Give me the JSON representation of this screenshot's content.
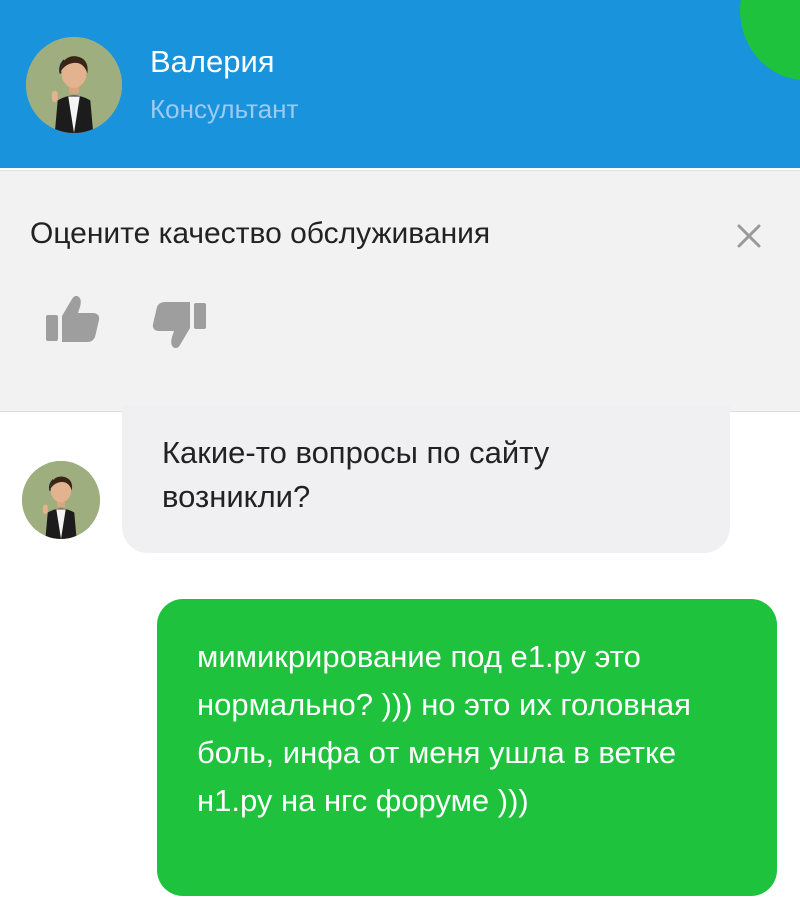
{
  "theme": {
    "header_bg": "#1a93dd",
    "accent_green": "#1ec23d",
    "panel_bg": "#f2f2f2",
    "incoming_bubble_bg": "#f0f0f2",
    "outgoing_bubble_bg": "#1ec23d"
  },
  "header": {
    "agent_name": "Валерия",
    "agent_role": "Консультант",
    "avatar_icon": "agent-avatar"
  },
  "rating": {
    "title": "Оцените качество обслуживания",
    "close_icon": "close-icon",
    "like_icon": "thumbs-up-icon",
    "dislike_icon": "thumbs-down-icon"
  },
  "messages": [
    {
      "direction": "incoming",
      "text": "Какие-то вопросы по сайту возникли?"
    },
    {
      "direction": "outgoing",
      "text": "мимикрирование под е1.ру это нормально? ))) но это их головная боль, инфа от меня ушла в ветке н1.ру на нгс форуме )))"
    }
  ]
}
